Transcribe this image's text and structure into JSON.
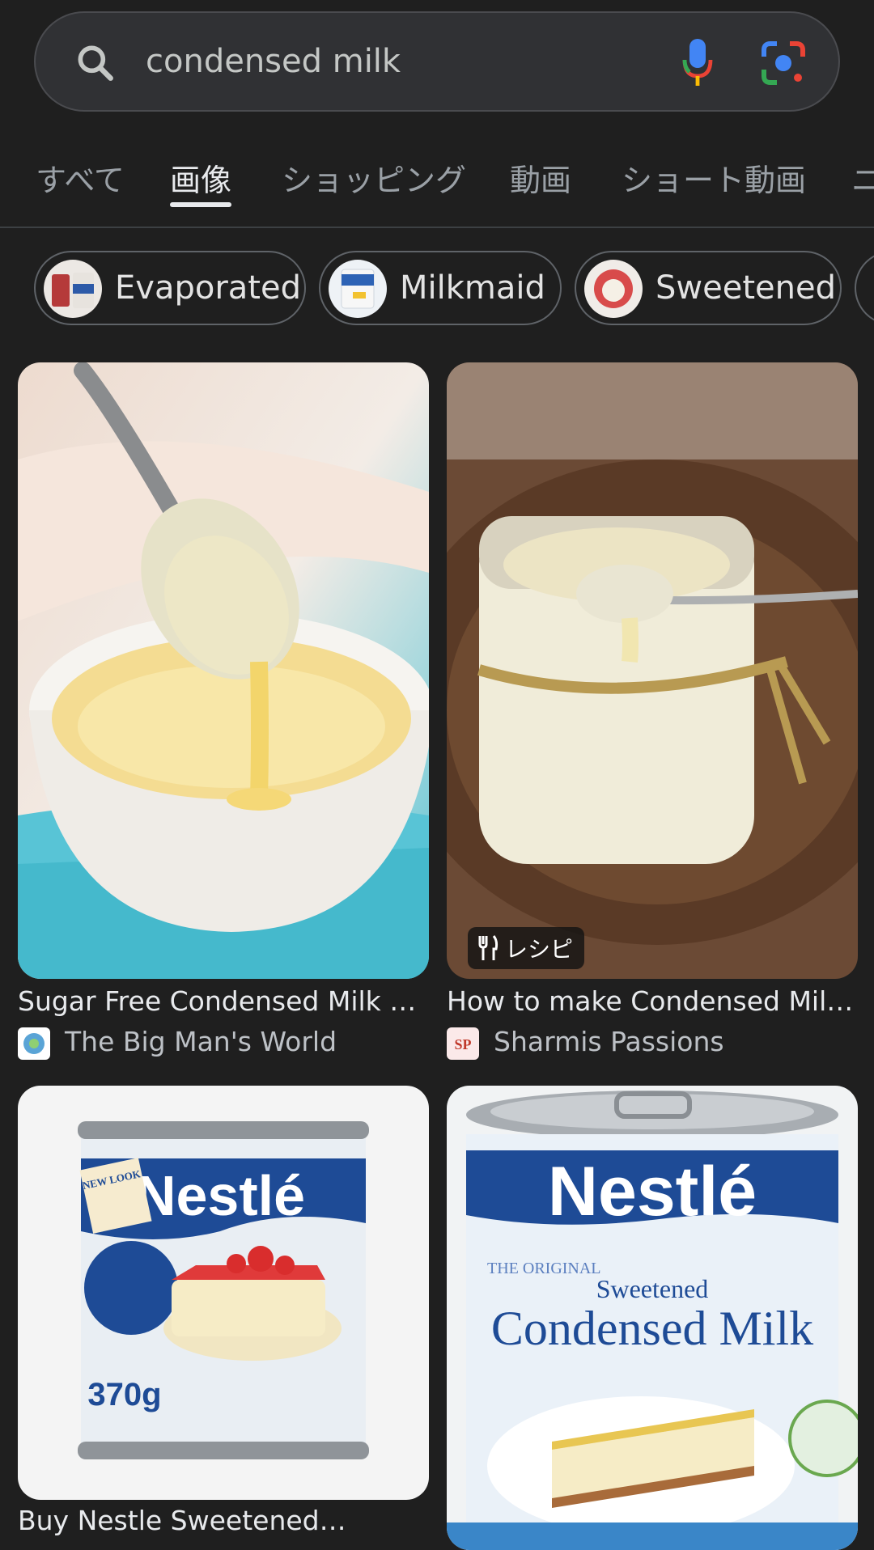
{
  "search": {
    "query": "condensed milk"
  },
  "tabs": [
    "すべて",
    "画像",
    "ショッピング",
    "動画",
    "ショート動画",
    "ニ"
  ],
  "active_tab": "画像",
  "chips": [
    "Evaporated",
    "Milkmaid",
    "Sweetened"
  ],
  "results": [
    {
      "caption": "Sugar Free Condensed Milk {3…",
      "source": "The Big Man's World"
    },
    {
      "caption": "How to make Condensed Milk |…",
      "source": "Sharmis Passions",
      "badge": "レシピ"
    },
    {
      "caption": "Buy Nestle Sweetened…",
      "source": ""
    },
    {
      "caption": "",
      "source": ""
    }
  ],
  "product_labels": {
    "nestle_1": {
      "brand": "Nestlé",
      "weight": "370g",
      "new_look": "NEW LOOK"
    },
    "nestle_2": {
      "brand": "Nestlé",
      "line1": "THE ORIGINAL",
      "line2": "Sweetened",
      "line3": "Condensed Milk"
    }
  },
  "colors": {
    "background": "#1f1f1f",
    "search_bg": "#303134",
    "text_primary": "#e8eaed",
    "text_secondary": "#bdc1c6"
  }
}
